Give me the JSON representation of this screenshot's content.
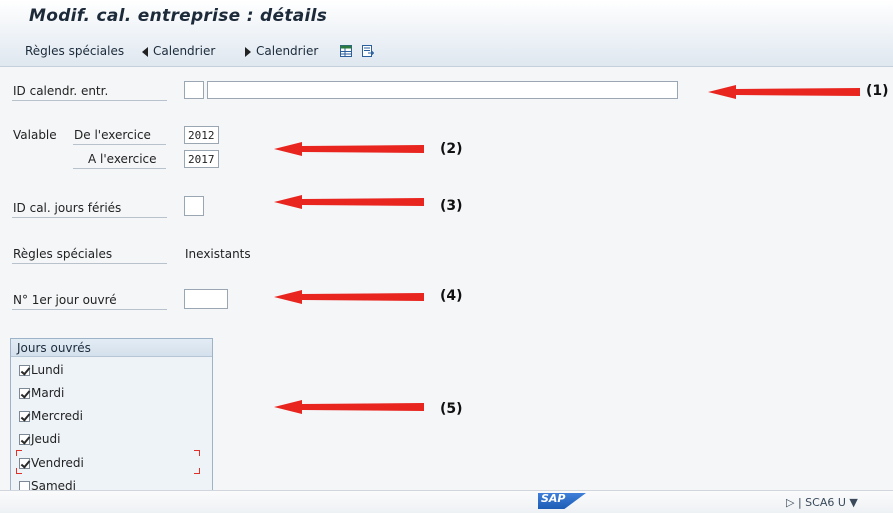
{
  "window": {
    "title": "Modif. cal. entreprise : détails"
  },
  "toolbar": {
    "special_rules": "Règles spéciales",
    "prev_calendar": "Calendrier",
    "next_calendar": "Calendrier",
    "icons": [
      "table-icon",
      "export-icon"
    ]
  },
  "fields": {
    "calendar_id": {
      "label": "ID calendr. entr.",
      "value": "",
      "description_value": ""
    },
    "valid": {
      "label": "Valable",
      "from_label": "De l'exercice",
      "from_value": "2012",
      "to_label": "A l'exercice",
      "to_value": "2017"
    },
    "holiday_calendar": {
      "label": "ID cal. jours fériés",
      "value": ""
    },
    "special_rules": {
      "label": "Règles spéciales",
      "value": "Inexistants"
    },
    "first_workday": {
      "label": "N° 1er jour ouvré",
      "value": ""
    }
  },
  "workdays": {
    "title": "Jours ouvrés",
    "days": [
      {
        "label": "Lundi",
        "checked": true
      },
      {
        "label": "Mardi",
        "checked": true
      },
      {
        "label": "Mercredi",
        "checked": true
      },
      {
        "label": "Jeudi",
        "checked": true
      },
      {
        "label": "Vendredi",
        "checked": true
      },
      {
        "label": "Samedi",
        "checked": false
      }
    ]
  },
  "annotations": {
    "color": "#e8251f",
    "markers": [
      "(1)",
      "(2)",
      "(3)",
      "(4)",
      "(5)"
    ]
  },
  "status": {
    "system": "SCA6 U ▼",
    "logo": "SAP"
  },
  "colors": {
    "accent": "#1d5cb5",
    "annotation": "#e8251f"
  }
}
